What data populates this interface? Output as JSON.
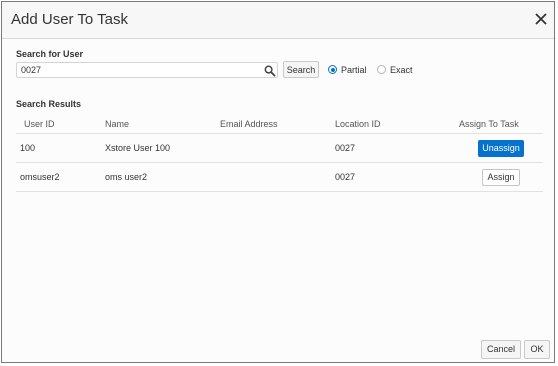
{
  "dialog": {
    "title": "Add User To Task"
  },
  "search": {
    "label": "Search for User",
    "value": "0027",
    "button_label": "Search",
    "match_modes": [
      {
        "label": "Partial",
        "selected": true
      },
      {
        "label": "Exact",
        "selected": false
      }
    ]
  },
  "results": {
    "label": "Search Results",
    "columns": [
      "User ID",
      "Name",
      "Email Address",
      "Location ID",
      "Assign To Task"
    ],
    "rows": [
      {
        "user_id": "100",
        "name": "Xstore User 100",
        "email": "",
        "location_id": "0027",
        "action": "Unassign"
      },
      {
        "user_id": "omsuser2",
        "name": "oms user2",
        "email": "",
        "location_id": "0027",
        "action": "Assign"
      }
    ]
  },
  "footer": {
    "cancel_label": "Cancel",
    "ok_label": "OK"
  },
  "colors": {
    "accent": "#0572ce"
  },
  "icons": {
    "close": "close-icon",
    "search": "search-icon"
  }
}
